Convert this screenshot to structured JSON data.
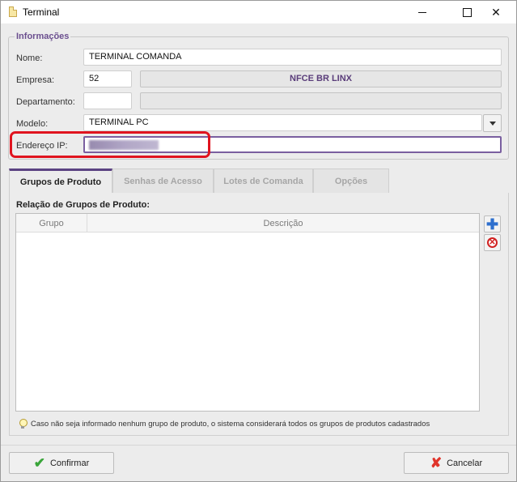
{
  "window": {
    "title": "Terminal",
    "icons": {
      "app": "document-icon",
      "minimize": "minimize-icon",
      "maximize": "maximize-icon",
      "close": "close-icon"
    },
    "close_glyph": "✕"
  },
  "info_group": {
    "title": "Informações",
    "nome": {
      "label": "Nome:",
      "value": "TERMINAL COMANDA"
    },
    "empresa": {
      "label": "Empresa:",
      "code": "52",
      "name": "NFCE BR LINX"
    },
    "departamento": {
      "label": "Departamento:",
      "code": "",
      "name": ""
    },
    "modelo": {
      "label": "Modelo:",
      "value": "TERMINAL PC"
    },
    "endereco_ip": {
      "label": "Endereço IP:",
      "value": ""
    }
  },
  "tabs": [
    {
      "label": "Grupos de Produto",
      "active": true
    },
    {
      "label": "Senhas de Acesso",
      "active": false
    },
    {
      "label": "Lotes de Comanda",
      "active": false
    },
    {
      "label": "Opções",
      "active": false
    }
  ],
  "product_groups": {
    "section_label": "Relação de Grupos de Produto:",
    "columns": [
      "Grupo",
      "Descrição"
    ],
    "rows": [],
    "add_glyph": "✚",
    "remove_glyph": "✕",
    "hint": "Caso não seja informado nenhum grupo de produto, o sistema considerará todos os grupos de produtos cadastrados"
  },
  "footer": {
    "confirm_label": "Confirmar",
    "cancel_label": "Cancelar",
    "confirm_glyph": "✔",
    "cancel_glyph": "✘"
  },
  "colors": {
    "accent": "#6b4f8f",
    "highlight": "#e0141f"
  }
}
